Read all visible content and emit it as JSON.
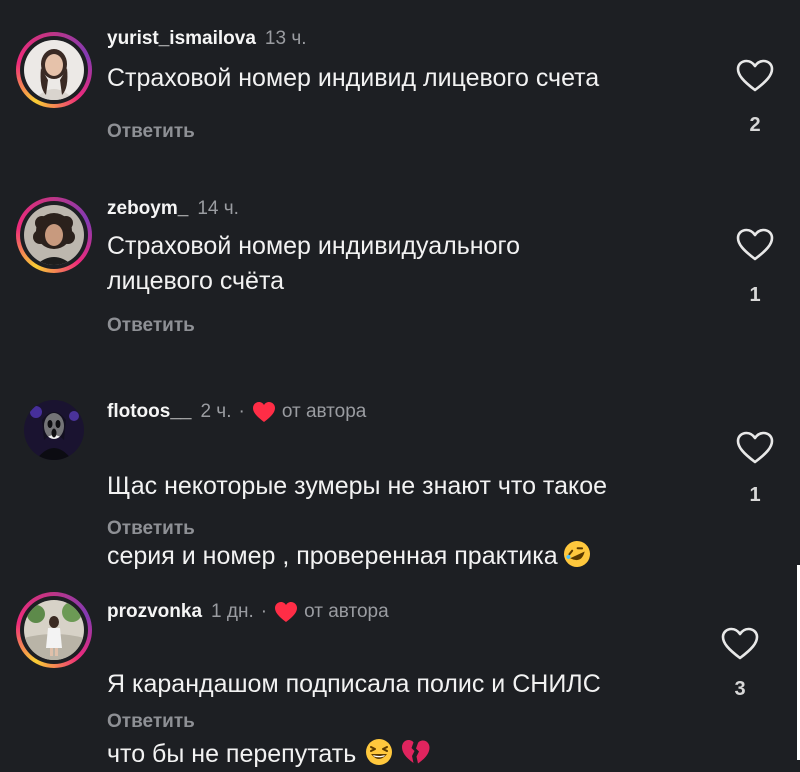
{
  "comments": [
    {
      "username": "yurist_ismailova",
      "time": "13 ч.",
      "text": "Страховой номер индивид лицевого счета",
      "reply_label": "Ответить",
      "like_count": "2"
    },
    {
      "username": "zeboym_",
      "time": "14 ч.",
      "text": "Страховой номер индивидуального\nлицевого счёта",
      "reply_label": "Ответить",
      "like_count": "1"
    },
    {
      "username": "flotoos__",
      "time": "2 ч.",
      "separator": "·",
      "author_label": "от автора",
      "text_line1": "Щас некоторые зумеры не знают что такое",
      "text_line2": "серия и номер , проверенная практика",
      "reply_label": "Ответить",
      "like_count": "1"
    },
    {
      "username": "prozvonka",
      "time": "1 дн.",
      "separator": "·",
      "author_label": "от автора",
      "text_line1": "Я карандашом подписала полис и СНИЛС",
      "text_line2": "что бы не перепутать",
      "reply_label": "Ответить",
      "like_count": "3"
    }
  ],
  "icons": {
    "like": "heart-outline-icon",
    "author_liked": "red-heart-icon",
    "emoji_comment3": "rolling-on-floor-laughing-emoji",
    "emoji_comment4_a": "grinning-squinting-face-emoji",
    "emoji_comment4_b": "broken-heart-emoji"
  },
  "colors": {
    "background": "#1d1f23",
    "heart_red": "#ff2d46",
    "secondary_text": "#9a9ca1"
  }
}
